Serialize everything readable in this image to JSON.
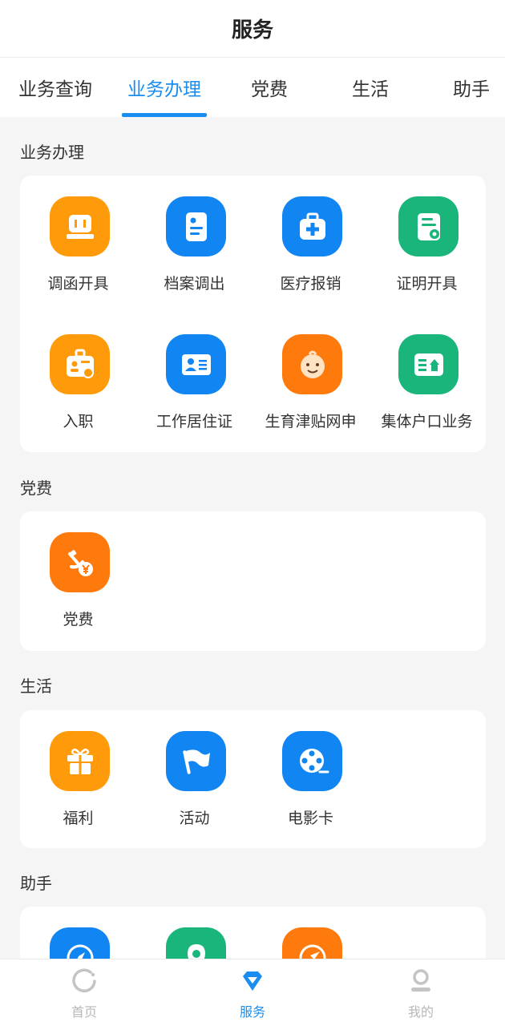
{
  "header": {
    "title": "服务"
  },
  "tabs": [
    {
      "label": "业务查询"
    },
    {
      "label": "业务办理"
    },
    {
      "label": "党费"
    },
    {
      "label": "生活"
    },
    {
      "label": "助手"
    }
  ],
  "active_tab": "业务办理",
  "sections": {
    "business": {
      "title": "业务办理",
      "items": [
        {
          "label": "调函开具",
          "icon": "letter-stamp-icon",
          "color": "#ff9a0a"
        },
        {
          "label": "档案调出",
          "icon": "document-file-icon",
          "color": "#1185f2"
        },
        {
          "label": "医疗报销",
          "icon": "medical-kit-icon",
          "color": "#1185f2"
        },
        {
          "label": "证明开具",
          "icon": "certificate-icon",
          "color": "#19b57b"
        },
        {
          "label": "入职",
          "icon": "badge-card-icon",
          "color": "#ff9a0a"
        },
        {
          "label": "工作居住证",
          "icon": "id-card-icon",
          "color": "#1185f2"
        },
        {
          "label": "生育津贴网申",
          "icon": "baby-face-icon",
          "color": "#ff7a0d"
        },
        {
          "label": "集体户口业务",
          "icon": "household-icon",
          "color": "#19b57b"
        }
      ]
    },
    "party": {
      "title": "党费",
      "items": [
        {
          "label": "党费",
          "icon": "party-fee-icon",
          "color": "#ff7a0d"
        }
      ]
    },
    "life": {
      "title": "生活",
      "items": [
        {
          "label": "福利",
          "icon": "gift-icon",
          "color": "#ff9a0a"
        },
        {
          "label": "活动",
          "icon": "flag-icon",
          "color": "#1185f2"
        },
        {
          "label": "电影卡",
          "icon": "film-reel-icon",
          "color": "#1185f2"
        }
      ]
    },
    "assistant": {
      "title": "助手",
      "items": [
        {
          "icon": "compass-icon",
          "color": "#1185f2"
        },
        {
          "icon": "location-pin-icon",
          "color": "#19b57b"
        },
        {
          "icon": "navigation-icon",
          "color": "#ff7a0d"
        }
      ]
    }
  },
  "bottom_nav": [
    {
      "label": "首页",
      "icon": "home-icon"
    },
    {
      "label": "服务",
      "icon": "service-icon",
      "active": true
    },
    {
      "label": "我的",
      "icon": "profile-icon"
    }
  ],
  "colors": {
    "accent": "#1a8ef0",
    "inactive": "#b7b7b7"
  }
}
